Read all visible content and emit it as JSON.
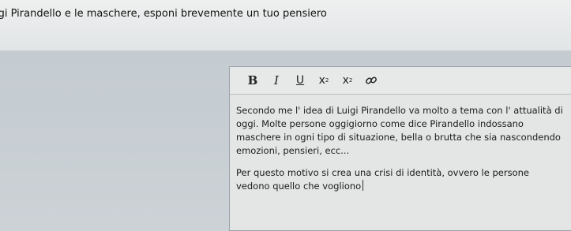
{
  "question": {
    "text": "igi Pirandello e le maschere, esponi brevemente un tuo pensiero"
  },
  "toolbar": {
    "bold": "B",
    "italic": "I",
    "underline": "U",
    "superscript": "x",
    "subscript": "x",
    "link_icon": "link-icon"
  },
  "editor": {
    "paragraph1": "Secondo me l' idea di Luigi Pirandello va molto a tema con l' attualità di oggi. Molte persone oggigiorno come dice Pirandello indossano maschere in ogni tipo di situazione, bella o brutta che sia nascondendo emozioni, pensieri, ecc...",
    "paragraph2": "Per questo motivo si crea una crisi di identità, ovvero le persone vedono quello che vogliono"
  }
}
